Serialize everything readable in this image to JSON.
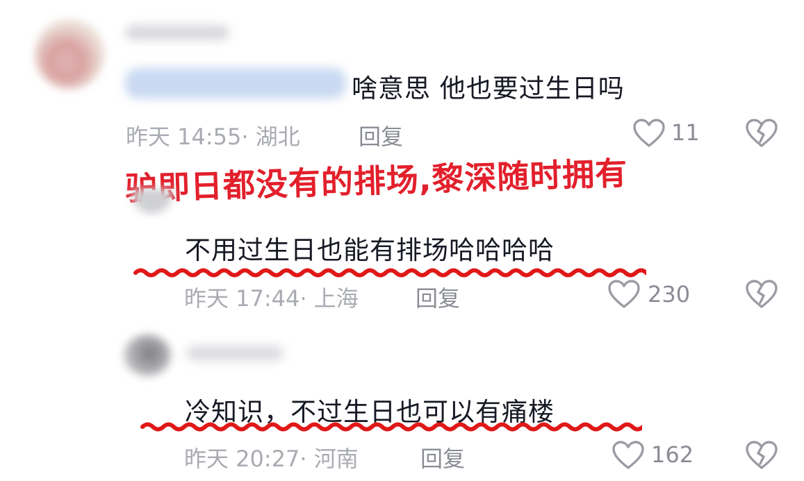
{
  "comments": [
    {
      "text": "啥意思 他也要过生日吗",
      "time": "昨天 14:55· 湖北",
      "reply_label": "回复",
      "likes": "11"
    },
    {
      "text": "不用过生日也能有排场哈哈哈哈",
      "time": "昨天 17:44· 上海",
      "reply_label": "回复",
      "likes": "230"
    },
    {
      "text": "冷知识，不过生日也可以有痛楼",
      "time": "昨天 20:27· 河南",
      "reply_label": "回复",
      "likes": "162"
    }
  ],
  "overlay_caption": "驴即日都没有的排场,黎深随时拥有",
  "colors": {
    "overlay_red": "#e2202c",
    "underline_red": "#e01818",
    "meta_gray": "#a9abb2",
    "text_dark": "#161823"
  },
  "icons": [
    "heart-outline-icon",
    "broken-heart-icon"
  ]
}
